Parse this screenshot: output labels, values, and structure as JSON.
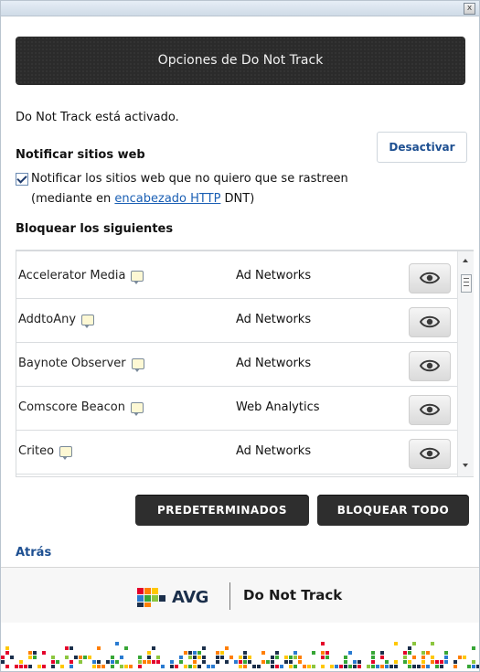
{
  "window": {
    "close_label": "x"
  },
  "header": {
    "title": "Opciones de Do Not Track"
  },
  "status_text": "Do Not Track está activado.",
  "notify": {
    "section_title": "Notificar sitios web",
    "deactivate_label": "Desactivar",
    "checkbox_checked": true,
    "checkbox_label": "Notificar los sitios web que no quiero que se rastreen",
    "line2_prefix": "(mediante en ",
    "line2_link": "encabezado HTTP",
    "line2_suffix": " DNT)"
  },
  "block": {
    "section_title": "Bloquear los siguientes",
    "rows": [
      {
        "name": "Accelerator Media",
        "category": "Ad Networks"
      },
      {
        "name": "AddtoAny",
        "category": "Ad Networks"
      },
      {
        "name": "Baynote Observer",
        "category": "Ad Networks"
      },
      {
        "name": "Comscore Beacon",
        "category": "Web Analytics"
      },
      {
        "name": "Criteo",
        "category": "Ad Networks"
      }
    ]
  },
  "buttons": {
    "defaults": "PREDETERMINADOS",
    "block_all": "BLOQUEAR TODO"
  },
  "back_label": "Atrás",
  "footer": {
    "brand": "AVG",
    "product": "Do Not Track"
  },
  "colors": {
    "link": "#1a5fb4",
    "dark_button": "#2e2e2e",
    "header_bg": "#2b2b2b",
    "brand_navy": "#1b2f4b"
  },
  "icons": [
    "close-icon",
    "checkbox-icon",
    "comment-icon",
    "eye-icon",
    "scroll-arrow-icon",
    "avg-logo-icon"
  ]
}
